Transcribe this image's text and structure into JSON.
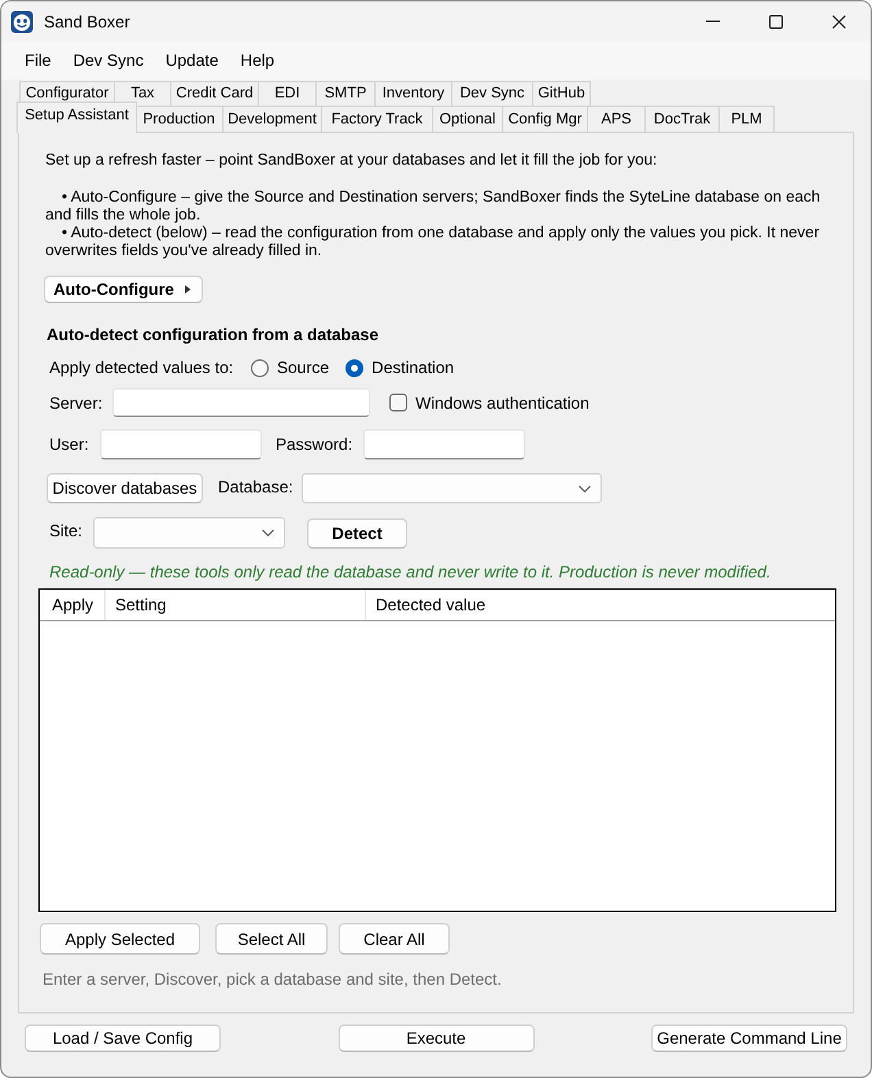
{
  "window": {
    "title": "Sand Boxer"
  },
  "menu": [
    "File",
    "Dev Sync",
    "Update",
    "Help"
  ],
  "tab_rows": [
    {
      "tabs": [
        {
          "label": "Configurator",
          "selected": false
        },
        {
          "label": "Tax",
          "selected": false
        },
        {
          "label": "Credit Card",
          "selected": false
        },
        {
          "label": "EDI",
          "selected": false
        },
        {
          "label": "SMTP",
          "selected": false
        },
        {
          "label": "Inventory",
          "selected": false
        },
        {
          "label": "Dev Sync",
          "selected": false
        },
        {
          "label": "GitHub",
          "selected": false
        }
      ]
    },
    {
      "tabs": [
        {
          "label": "Setup Assistant",
          "selected": true
        },
        {
          "label": "Production",
          "selected": false
        },
        {
          "label": "Development",
          "selected": false
        },
        {
          "label": "Factory Track",
          "selected": false
        },
        {
          "label": "Optional",
          "selected": false
        },
        {
          "label": "Config Mgr",
          "selected": false
        },
        {
          "label": "APS",
          "selected": false
        },
        {
          "label": "DocTrak",
          "selected": false
        },
        {
          "label": "PLM",
          "selected": false
        }
      ]
    }
  ],
  "intro": "Set up a refresh faster – point SandBoxer at your databases and let it fill the job for you:",
  "bullets": [
    "• Auto-Configure – give the Source and Destination servers; SandBoxer finds the SyteLine database on each and fills the whole job.",
    "• Auto-detect (below) – read the configuration from one database and apply only the values you pick. It never overwrites fields you've already filled in."
  ],
  "auto_configure_button": "Auto-Configure",
  "detect": {
    "heading": "Auto-detect configuration from a database",
    "apply_label": "Apply detected values to:",
    "targets": [
      {
        "label": "Source",
        "selected": false
      },
      {
        "label": "Destination",
        "selected": true
      }
    ],
    "server": {
      "label": "Server:"
    },
    "windows_auth": {
      "label": "Windows authentication",
      "checked": false
    },
    "user": {
      "label": "User:"
    },
    "password": {
      "label": "Password:"
    },
    "discover_button": "Discover databases",
    "database": {
      "label": "Database:"
    },
    "site": {
      "label": "Site:"
    },
    "detect_button": "Detect",
    "note": "Read-only — these tools only read the database and never write to it. Production is never modified."
  },
  "table": {
    "columns": [
      "Apply",
      "Setting",
      "Detected value"
    ]
  },
  "table_buttons": [
    "Apply Selected",
    "Select All",
    "Clear All"
  ],
  "hint": "Enter a server, Discover, pick a database and site, then Detect.",
  "footer_buttons": [
    "Load / Save Config",
    "Execute",
    "Generate Command Line"
  ]
}
